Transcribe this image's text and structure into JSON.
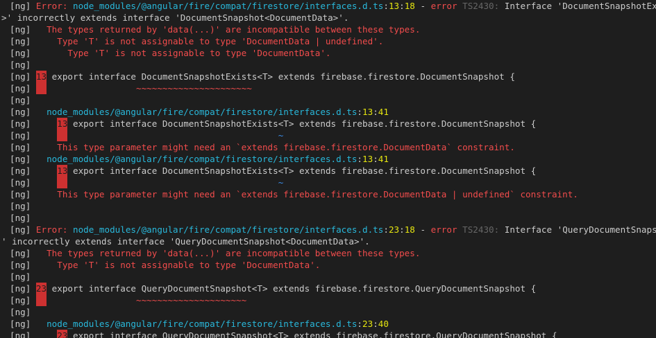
{
  "terminal": {
    "background": "#1e1e1e",
    "colors": {
      "default": "#cccccc",
      "error": "#f14c4c",
      "path": "#29b8db",
      "position": "#e5e510",
      "code": "#666666",
      "squiggle": "#f14c4c",
      "tilde": "#3b8eea",
      "gutter": "#cd3131"
    },
    "lines": [
      {
        "segments": [
          {
            "t": "[ng] ",
            "c": "def"
          },
          {
            "t": "Error: ",
            "c": "err"
          },
          {
            "t": "node_modules/@angular/fire/compat/firestore/interfaces.d.ts",
            "c": "path"
          },
          {
            "t": ":",
            "c": "def"
          },
          {
            "t": "13",
            "c": "pos"
          },
          {
            "t": ":",
            "c": "def"
          },
          {
            "t": "18",
            "c": "pos"
          },
          {
            "t": " - ",
            "c": "def"
          },
          {
            "t": "error",
            "c": "err"
          },
          {
            "t": " TS2430: ",
            "c": "code"
          },
          {
            "t": "Interface 'DocumentSnapshotExists<T",
            "c": "def"
          }
        ]
      },
      {
        "segments": [
          {
            "t": ">' incorrectly extends interface 'DocumentSnapshot<DocumentData>'.",
            "c": "def"
          }
        ]
      },
      {
        "segments": [
          {
            "t": "[ng]   ",
            "c": "def"
          },
          {
            "t": "The types returned by 'data(...)' are incompatible between these types.",
            "c": "err"
          }
        ]
      },
      {
        "segments": [
          {
            "t": "[ng]     ",
            "c": "def"
          },
          {
            "t": "Type 'T' is not assignable to type 'DocumentData | undefined'.",
            "c": "err"
          }
        ]
      },
      {
        "segments": [
          {
            "t": "[ng]       ",
            "c": "def"
          },
          {
            "t": "Type 'T' is not assignable to type 'DocumentData'.",
            "c": "err"
          }
        ]
      },
      {
        "segments": [
          {
            "t": "[ng]",
            "c": "def"
          }
        ]
      },
      {
        "segments": [
          {
            "t": "[ng] ",
            "c": "def"
          },
          {
            "t": "13",
            "c": "gutter"
          },
          {
            "t": " export interface DocumentSnapshotExists<T> extends firebase.firestore.DocumentSnapshot {",
            "c": "def"
          }
        ]
      },
      {
        "segments": [
          {
            "t": "[ng] ",
            "c": "def"
          },
          {
            "t": "  ",
            "c": "gutter"
          },
          {
            "t": "                 ",
            "c": "def"
          },
          {
            "t": "~~~~~~~~~~~~~~~~~~~~~~",
            "c": "squig"
          }
        ]
      },
      {
        "segments": [
          {
            "t": "[ng]",
            "c": "def"
          }
        ]
      },
      {
        "segments": [
          {
            "t": "[ng]   ",
            "c": "def"
          },
          {
            "t": "node_modules/@angular/fire/compat/firestore/interfaces.d.ts",
            "c": "path"
          },
          {
            "t": ":",
            "c": "def"
          },
          {
            "t": "13",
            "c": "pos"
          },
          {
            "t": ":",
            "c": "def"
          },
          {
            "t": "41",
            "c": "pos"
          }
        ]
      },
      {
        "segments": [
          {
            "t": "[ng]     ",
            "c": "def"
          },
          {
            "t": "13",
            "c": "gutter"
          },
          {
            "t": " export interface DocumentSnapshotExists<T> extends firebase.firestore.DocumentSnapshot {",
            "c": "def"
          }
        ]
      },
      {
        "segments": [
          {
            "t": "[ng]     ",
            "c": "def"
          },
          {
            "t": "  ",
            "c": "gutter"
          },
          {
            "t": "                                        ",
            "c": "def"
          },
          {
            "t": "~",
            "c": "tilde"
          }
        ]
      },
      {
        "segments": [
          {
            "t": "[ng]     ",
            "c": "def"
          },
          {
            "t": "This type parameter might need an `extends firebase.firestore.DocumentData` constraint.",
            "c": "err"
          }
        ]
      },
      {
        "segments": [
          {
            "t": "[ng]   ",
            "c": "def"
          },
          {
            "t": "node_modules/@angular/fire/compat/firestore/interfaces.d.ts",
            "c": "path"
          },
          {
            "t": ":",
            "c": "def"
          },
          {
            "t": "13",
            "c": "pos"
          },
          {
            "t": ":",
            "c": "def"
          },
          {
            "t": "41",
            "c": "pos"
          }
        ]
      },
      {
        "segments": [
          {
            "t": "[ng]     ",
            "c": "def"
          },
          {
            "t": "13",
            "c": "gutter"
          },
          {
            "t": " export interface DocumentSnapshotExists<T> extends firebase.firestore.DocumentSnapshot {",
            "c": "def"
          }
        ]
      },
      {
        "segments": [
          {
            "t": "[ng]     ",
            "c": "def"
          },
          {
            "t": "  ",
            "c": "gutter"
          },
          {
            "t": "                                        ",
            "c": "def"
          },
          {
            "t": "~",
            "c": "tilde"
          }
        ]
      },
      {
        "segments": [
          {
            "t": "[ng]     ",
            "c": "def"
          },
          {
            "t": "This type parameter might need an `extends firebase.firestore.DocumentData | undefined` constraint.",
            "c": "err"
          }
        ]
      },
      {
        "segments": [
          {
            "t": "[ng]",
            "c": "def"
          }
        ]
      },
      {
        "segments": [
          {
            "t": "[ng]",
            "c": "def"
          }
        ]
      },
      {
        "segments": [
          {
            "t": "[ng] ",
            "c": "def"
          },
          {
            "t": "Error: ",
            "c": "err"
          },
          {
            "t": "node_modules/@angular/fire/compat/firestore/interfaces.d.ts",
            "c": "path"
          },
          {
            "t": ":",
            "c": "def"
          },
          {
            "t": "23",
            "c": "pos"
          },
          {
            "t": ":",
            "c": "def"
          },
          {
            "t": "18",
            "c": "pos"
          },
          {
            "t": " - ",
            "c": "def"
          },
          {
            "t": "error",
            "c": "err"
          },
          {
            "t": " TS2430: ",
            "c": "code"
          },
          {
            "t": "Interface 'QueryDocumentSnapshot<T>",
            "c": "def"
          }
        ]
      },
      {
        "segments": [
          {
            "t": "' incorrectly extends interface 'QueryDocumentSnapshot<DocumentData>'.",
            "c": "def"
          }
        ]
      },
      {
        "segments": [
          {
            "t": "[ng]   ",
            "c": "def"
          },
          {
            "t": "The types returned by 'data(...)' are incompatible between these types.",
            "c": "err"
          }
        ]
      },
      {
        "segments": [
          {
            "t": "[ng]     ",
            "c": "def"
          },
          {
            "t": "Type 'T' is not assignable to type 'DocumentData'.",
            "c": "err"
          }
        ]
      },
      {
        "segments": [
          {
            "t": "[ng]",
            "c": "def"
          }
        ]
      },
      {
        "segments": [
          {
            "t": "[ng] ",
            "c": "def"
          },
          {
            "t": "23",
            "c": "gutter"
          },
          {
            "t": " export interface QueryDocumentSnapshot<T> extends firebase.firestore.QueryDocumentSnapshot {",
            "c": "def"
          }
        ]
      },
      {
        "segments": [
          {
            "t": "[ng] ",
            "c": "def"
          },
          {
            "t": "  ",
            "c": "gutter"
          },
          {
            "t": "                 ",
            "c": "def"
          },
          {
            "t": "~~~~~~~~~~~~~~~~~~~~~",
            "c": "squig"
          }
        ]
      },
      {
        "segments": [
          {
            "t": "[ng]",
            "c": "def"
          }
        ]
      },
      {
        "segments": [
          {
            "t": "[ng]   ",
            "c": "def"
          },
          {
            "t": "node_modules/@angular/fire/compat/firestore/interfaces.d.ts",
            "c": "path"
          },
          {
            "t": ":",
            "c": "def"
          },
          {
            "t": "23",
            "c": "pos"
          },
          {
            "t": ":",
            "c": "def"
          },
          {
            "t": "40",
            "c": "pos"
          }
        ]
      },
      {
        "segments": [
          {
            "t": "[ng]     ",
            "c": "def"
          },
          {
            "t": "23",
            "c": "gutter"
          },
          {
            "t": " export interface QueryDocumentSnapshot<T> extends firebase.firestore.QueryDocumentSnapshot {",
            "c": "def"
          }
        ]
      }
    ]
  }
}
